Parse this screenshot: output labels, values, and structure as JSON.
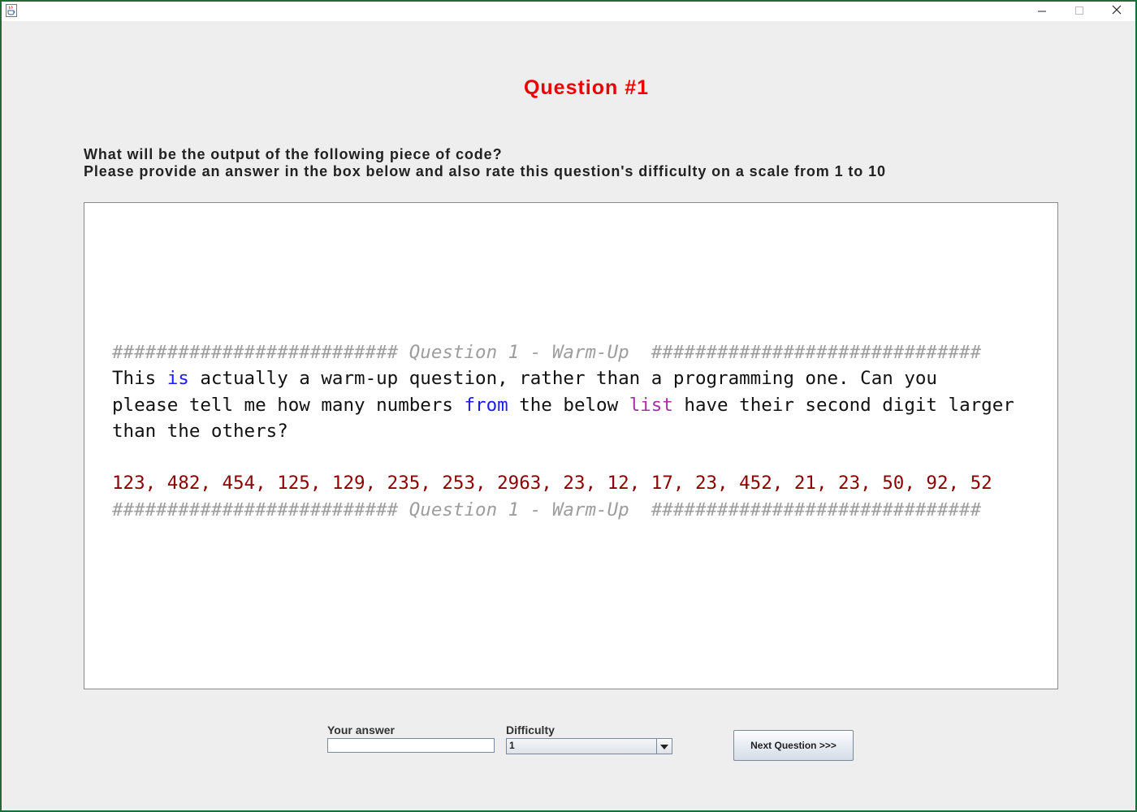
{
  "window": {
    "controls": {
      "minimize": "minimize-icon",
      "maximize": "maximize-icon",
      "close": "close-icon"
    },
    "app_icon": "java-coffee-cup-icon"
  },
  "question": {
    "title": "Question #1",
    "instruction_line1": "What will be the output of the following piece of code?",
    "instruction_line2": "Please provide an answer in the box below and also rate this question's difficulty on a scale from 1 to 10"
  },
  "code": {
    "header_comment": "########################## Question 1 - Warm-Up  ##############################",
    "line1_a": "This ",
    "line1_kw": "is",
    "line1_b": " actually a warm-up question, rather than a programming one. Can you",
    "line2_a": "please tell me how many numbers ",
    "line2_kw": "from",
    "line2_b": " the below ",
    "line2_bi": "list",
    "line2_c": " have their second digit larger",
    "line3": "than the others?",
    "numbers": "123, 482, 454, 125, 129, 235, 253, 2963, 23, 12, 17, 23, 452, 21, 23, 50, 92, 52",
    "footer_comment": "########################## Question 1 - Warm-Up  ##############################"
  },
  "form": {
    "answer_label": "Your answer",
    "answer_value": "",
    "difficulty_label": "Difficulty",
    "difficulty_value": "1",
    "next_button": "Next Question >>>"
  },
  "colors": {
    "title": "#ee0000",
    "comment": "#9d9d9d",
    "keyword": "#1a1aff",
    "builtin": "#a52fa5",
    "number": "#8b0000"
  }
}
